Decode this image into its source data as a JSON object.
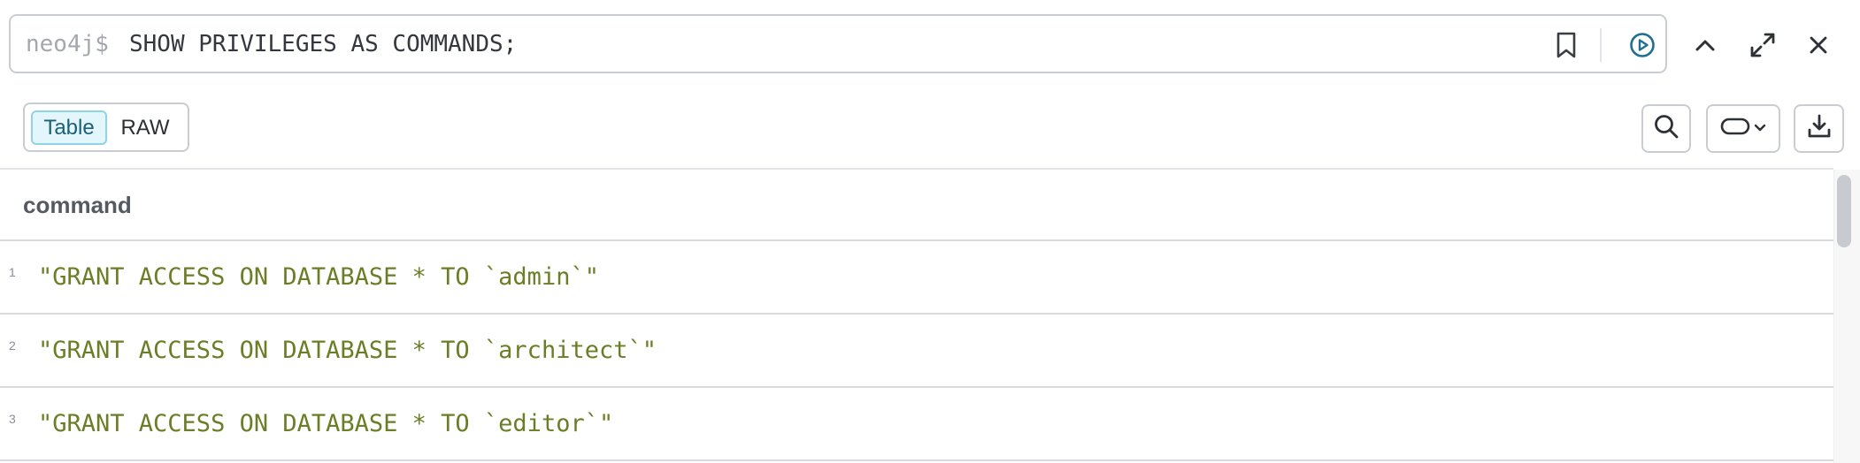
{
  "query": {
    "prompt": "neo4j$",
    "text": "SHOW PRIVILEGES AS COMMANDS;",
    "icons": {
      "bookmark": "bookmark-icon",
      "run": "play-circle-icon",
      "collapse": "chevron-up-icon",
      "fullscreen": "expand-icon",
      "close": "close-icon"
    },
    "accent_color": "#1f6f93"
  },
  "view_toggle": {
    "table_label": "Table",
    "raw_label": "RAW",
    "selected": "Table"
  },
  "toolbar": {
    "icons": [
      "search-icon",
      "pill-shape-icon",
      "download-icon"
    ]
  },
  "table": {
    "columns": [
      "command"
    ],
    "rows": [
      {
        "index": "1",
        "command": "\"GRANT ACCESS ON DATABASE * TO `admin`\""
      },
      {
        "index": "2",
        "command": "\"GRANT ACCESS ON DATABASE * TO `architect`\""
      },
      {
        "index": "3",
        "command": "\"GRANT ACCESS ON DATABASE * TO `editor`\""
      }
    ],
    "value_color": "#6b7d26"
  }
}
